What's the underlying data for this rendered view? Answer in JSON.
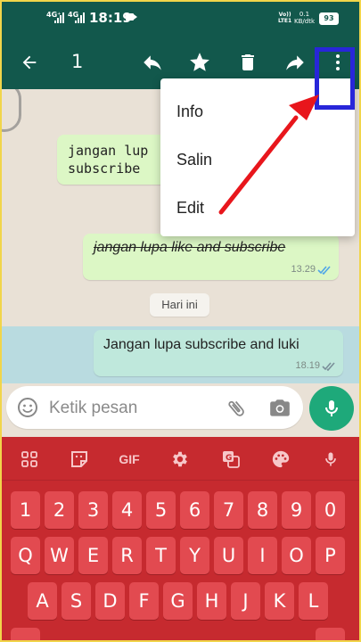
{
  "status_bar": {
    "net1": "4G⁺",
    "net2": "4G",
    "time": "18:19",
    "volte_top": "Vo))",
    "volte_bottom": "LTE1",
    "speed_value": "0.1",
    "speed_unit": "KB/dtk",
    "battery": "93"
  },
  "toolbar": {
    "selected_count": "1",
    "icons": [
      "back-arrow-icon",
      "reply-icon",
      "star-icon",
      "delete-icon",
      "forward-icon",
      "more-vert-icon"
    ]
  },
  "chat": {
    "messages": [
      {
        "text": "jangan lupa like and\nsubscribe",
        "visible_lines": [
          "jangan lup",
          "subscribe"
        ]
      },
      {
        "text": "jangan lupa like and subscribe",
        "time": "13.29"
      },
      {
        "text": "Jangan lupa subscribe and luki",
        "time": "18.19"
      }
    ],
    "day_divider": "Hari ini"
  },
  "menu": {
    "items": [
      "Info",
      "Salin",
      "Edit"
    ]
  },
  "input": {
    "placeholder": "Ketik pesan"
  },
  "keyboard": {
    "toolbar": [
      "apps-icon",
      "sticker-icon",
      "GIF",
      "settings-icon",
      "translate-icon",
      "palette-icon",
      "mic-icon"
    ],
    "row_numbers": [
      "1",
      "2",
      "3",
      "4",
      "5",
      "6",
      "7",
      "8",
      "9",
      "0"
    ],
    "row_qwerty": [
      "Q",
      "W",
      "E",
      "R",
      "T",
      "Y",
      "U",
      "I",
      "O",
      "P"
    ],
    "row_asdf": [
      "A",
      "S",
      "D",
      "F",
      "G",
      "H",
      "J",
      "K",
      "L"
    ]
  },
  "colors": {
    "header": "#12584c",
    "bubble_out": "#dcf7c5",
    "selected_bubble": "#bfe8dc",
    "fab": "#1ea97a",
    "keyboard_bg": "#c62a2f",
    "key": "#e24a50",
    "annotation_box": "#2826d9",
    "annotation_arrow": "#e8161c"
  }
}
